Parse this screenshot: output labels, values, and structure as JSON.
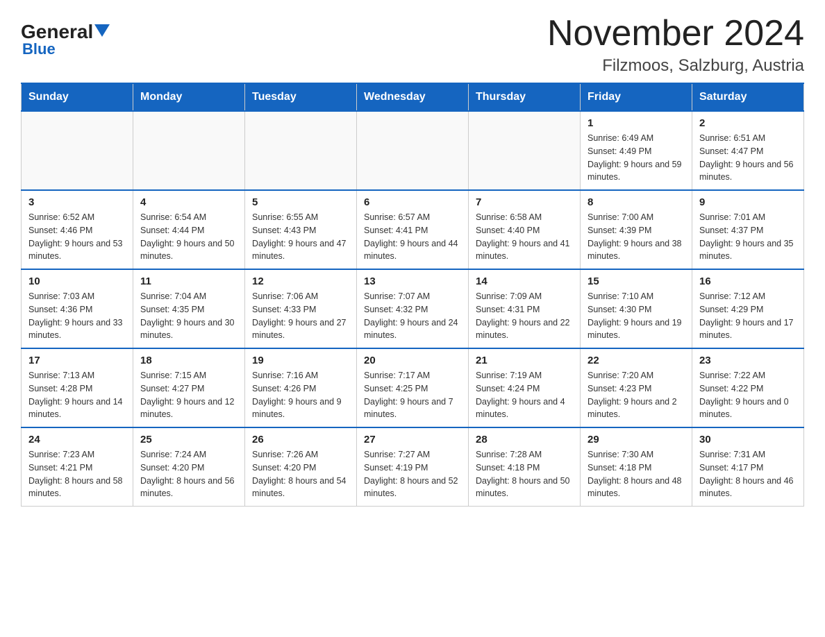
{
  "header": {
    "logo_general": "General",
    "logo_blue": "Blue",
    "title": "November 2024",
    "subtitle": "Filzmoos, Salzburg, Austria"
  },
  "weekdays": [
    "Sunday",
    "Monday",
    "Tuesday",
    "Wednesday",
    "Thursday",
    "Friday",
    "Saturday"
  ],
  "weeks": [
    [
      {
        "day": "",
        "sunrise": "",
        "sunset": "",
        "daylight": ""
      },
      {
        "day": "",
        "sunrise": "",
        "sunset": "",
        "daylight": ""
      },
      {
        "day": "",
        "sunrise": "",
        "sunset": "",
        "daylight": ""
      },
      {
        "day": "",
        "sunrise": "",
        "sunset": "",
        "daylight": ""
      },
      {
        "day": "",
        "sunrise": "",
        "sunset": "",
        "daylight": ""
      },
      {
        "day": "1",
        "sunrise": "Sunrise: 6:49 AM",
        "sunset": "Sunset: 4:49 PM",
        "daylight": "Daylight: 9 hours and 59 minutes."
      },
      {
        "day": "2",
        "sunrise": "Sunrise: 6:51 AM",
        "sunset": "Sunset: 4:47 PM",
        "daylight": "Daylight: 9 hours and 56 minutes."
      }
    ],
    [
      {
        "day": "3",
        "sunrise": "Sunrise: 6:52 AM",
        "sunset": "Sunset: 4:46 PM",
        "daylight": "Daylight: 9 hours and 53 minutes."
      },
      {
        "day": "4",
        "sunrise": "Sunrise: 6:54 AM",
        "sunset": "Sunset: 4:44 PM",
        "daylight": "Daylight: 9 hours and 50 minutes."
      },
      {
        "day": "5",
        "sunrise": "Sunrise: 6:55 AM",
        "sunset": "Sunset: 4:43 PM",
        "daylight": "Daylight: 9 hours and 47 minutes."
      },
      {
        "day": "6",
        "sunrise": "Sunrise: 6:57 AM",
        "sunset": "Sunset: 4:41 PM",
        "daylight": "Daylight: 9 hours and 44 minutes."
      },
      {
        "day": "7",
        "sunrise": "Sunrise: 6:58 AM",
        "sunset": "Sunset: 4:40 PM",
        "daylight": "Daylight: 9 hours and 41 minutes."
      },
      {
        "day": "8",
        "sunrise": "Sunrise: 7:00 AM",
        "sunset": "Sunset: 4:39 PM",
        "daylight": "Daylight: 9 hours and 38 minutes."
      },
      {
        "day": "9",
        "sunrise": "Sunrise: 7:01 AM",
        "sunset": "Sunset: 4:37 PM",
        "daylight": "Daylight: 9 hours and 35 minutes."
      }
    ],
    [
      {
        "day": "10",
        "sunrise": "Sunrise: 7:03 AM",
        "sunset": "Sunset: 4:36 PM",
        "daylight": "Daylight: 9 hours and 33 minutes."
      },
      {
        "day": "11",
        "sunrise": "Sunrise: 7:04 AM",
        "sunset": "Sunset: 4:35 PM",
        "daylight": "Daylight: 9 hours and 30 minutes."
      },
      {
        "day": "12",
        "sunrise": "Sunrise: 7:06 AM",
        "sunset": "Sunset: 4:33 PM",
        "daylight": "Daylight: 9 hours and 27 minutes."
      },
      {
        "day": "13",
        "sunrise": "Sunrise: 7:07 AM",
        "sunset": "Sunset: 4:32 PM",
        "daylight": "Daylight: 9 hours and 24 minutes."
      },
      {
        "day": "14",
        "sunrise": "Sunrise: 7:09 AM",
        "sunset": "Sunset: 4:31 PM",
        "daylight": "Daylight: 9 hours and 22 minutes."
      },
      {
        "day": "15",
        "sunrise": "Sunrise: 7:10 AM",
        "sunset": "Sunset: 4:30 PM",
        "daylight": "Daylight: 9 hours and 19 minutes."
      },
      {
        "day": "16",
        "sunrise": "Sunrise: 7:12 AM",
        "sunset": "Sunset: 4:29 PM",
        "daylight": "Daylight: 9 hours and 17 minutes."
      }
    ],
    [
      {
        "day": "17",
        "sunrise": "Sunrise: 7:13 AM",
        "sunset": "Sunset: 4:28 PM",
        "daylight": "Daylight: 9 hours and 14 minutes."
      },
      {
        "day": "18",
        "sunrise": "Sunrise: 7:15 AM",
        "sunset": "Sunset: 4:27 PM",
        "daylight": "Daylight: 9 hours and 12 minutes."
      },
      {
        "day": "19",
        "sunrise": "Sunrise: 7:16 AM",
        "sunset": "Sunset: 4:26 PM",
        "daylight": "Daylight: 9 hours and 9 minutes."
      },
      {
        "day": "20",
        "sunrise": "Sunrise: 7:17 AM",
        "sunset": "Sunset: 4:25 PM",
        "daylight": "Daylight: 9 hours and 7 minutes."
      },
      {
        "day": "21",
        "sunrise": "Sunrise: 7:19 AM",
        "sunset": "Sunset: 4:24 PM",
        "daylight": "Daylight: 9 hours and 4 minutes."
      },
      {
        "day": "22",
        "sunrise": "Sunrise: 7:20 AM",
        "sunset": "Sunset: 4:23 PM",
        "daylight": "Daylight: 9 hours and 2 minutes."
      },
      {
        "day": "23",
        "sunrise": "Sunrise: 7:22 AM",
        "sunset": "Sunset: 4:22 PM",
        "daylight": "Daylight: 9 hours and 0 minutes."
      }
    ],
    [
      {
        "day": "24",
        "sunrise": "Sunrise: 7:23 AM",
        "sunset": "Sunset: 4:21 PM",
        "daylight": "Daylight: 8 hours and 58 minutes."
      },
      {
        "day": "25",
        "sunrise": "Sunrise: 7:24 AM",
        "sunset": "Sunset: 4:20 PM",
        "daylight": "Daylight: 8 hours and 56 minutes."
      },
      {
        "day": "26",
        "sunrise": "Sunrise: 7:26 AM",
        "sunset": "Sunset: 4:20 PM",
        "daylight": "Daylight: 8 hours and 54 minutes."
      },
      {
        "day": "27",
        "sunrise": "Sunrise: 7:27 AM",
        "sunset": "Sunset: 4:19 PM",
        "daylight": "Daylight: 8 hours and 52 minutes."
      },
      {
        "day": "28",
        "sunrise": "Sunrise: 7:28 AM",
        "sunset": "Sunset: 4:18 PM",
        "daylight": "Daylight: 8 hours and 50 minutes."
      },
      {
        "day": "29",
        "sunrise": "Sunrise: 7:30 AM",
        "sunset": "Sunset: 4:18 PM",
        "daylight": "Daylight: 8 hours and 48 minutes."
      },
      {
        "day": "30",
        "sunrise": "Sunrise: 7:31 AM",
        "sunset": "Sunset: 4:17 PM",
        "daylight": "Daylight: 8 hours and 46 minutes."
      }
    ]
  ]
}
